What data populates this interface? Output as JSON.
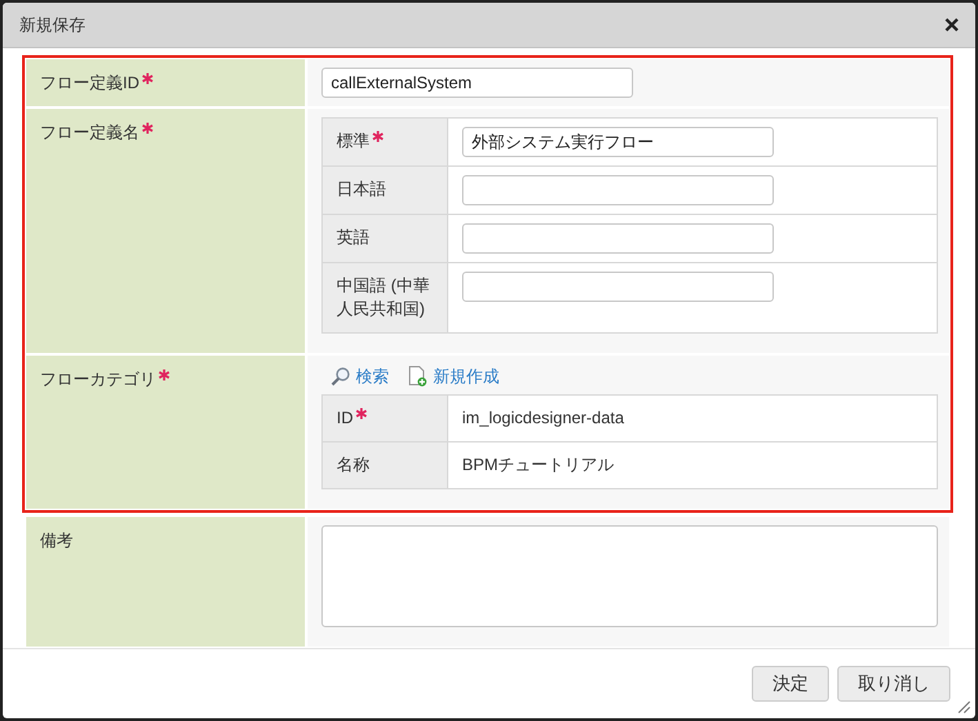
{
  "dialog": {
    "title": "新規保存"
  },
  "highlighted_fields": [
    {
      "kind": "text",
      "label": "フロー定義ID",
      "required": true,
      "value": "callExternalSystem"
    },
    {
      "kind": "locales",
      "label": "フロー定義名",
      "required": true,
      "rows": [
        {
          "label": "標準",
          "required": true,
          "value": "外部システム実行フロー"
        },
        {
          "label": "日本語",
          "required": false
        },
        {
          "label": "英語",
          "required": false
        },
        {
          "label": "中国語 (中華人民共和国)",
          "required": false
        }
      ]
    },
    {
      "kind": "category",
      "label": "フローカテゴリ",
      "required": true,
      "actions": [
        {
          "kind": "search",
          "label": "検索"
        },
        {
          "kind": "new",
          "label": "新規作成"
        }
      ],
      "rows": [
        {
          "label": "ID",
          "required": true,
          "value": "im_logicdesigner-data"
        },
        {
          "label": "名称",
          "required": false,
          "value": "BPMチュートリアル"
        }
      ]
    }
  ],
  "fields": [
    {
      "kind": "textarea",
      "label": "備考",
      "required": false
    }
  ],
  "buttons": [
    "決定",
    "取り消し"
  ]
}
